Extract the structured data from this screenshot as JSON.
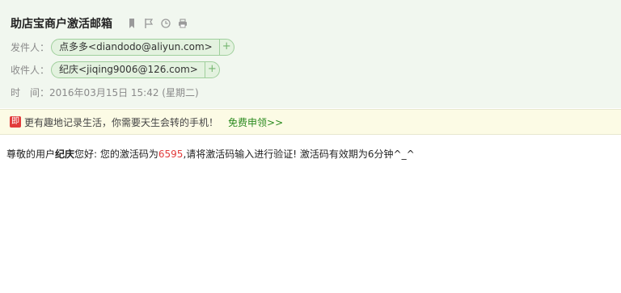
{
  "mail": {
    "subject": "助店宝商户激活邮箱",
    "from_label": "发件人：",
    "from_value": "点多多<diandodo@aliyun.com>",
    "to_label": "收件人：",
    "to_value": "纪庆<jiqing9006@126.com>",
    "add_symbol": "+",
    "time_label": "时　间：",
    "time_value": "2016年03月15日 15:42 (星期二)"
  },
  "toolbar": {
    "icons": [
      "bookmark-icon",
      "flag-icon",
      "clock-icon",
      "print-icon"
    ]
  },
  "promo": {
    "badge": "即",
    "text": "更有趣地记录生活，你需要天生会转的手机！",
    "link": "免费申领>>"
  },
  "body": {
    "greeting_pre": "尊敬的用户",
    "user_name": "纪庆",
    "greeting_post": "您好: 您的激活码为",
    "code": "6595",
    "rest": ",请将激活码输入进行验证! 激活码有效期为6分钟^_^"
  },
  "colors": {
    "header_bg": "#f1f7ef",
    "chip_bg": "#e3f2df",
    "promo_bg": "#fcfbe5",
    "code_color": "#e23b3b",
    "link_color": "#2a8a1e"
  }
}
